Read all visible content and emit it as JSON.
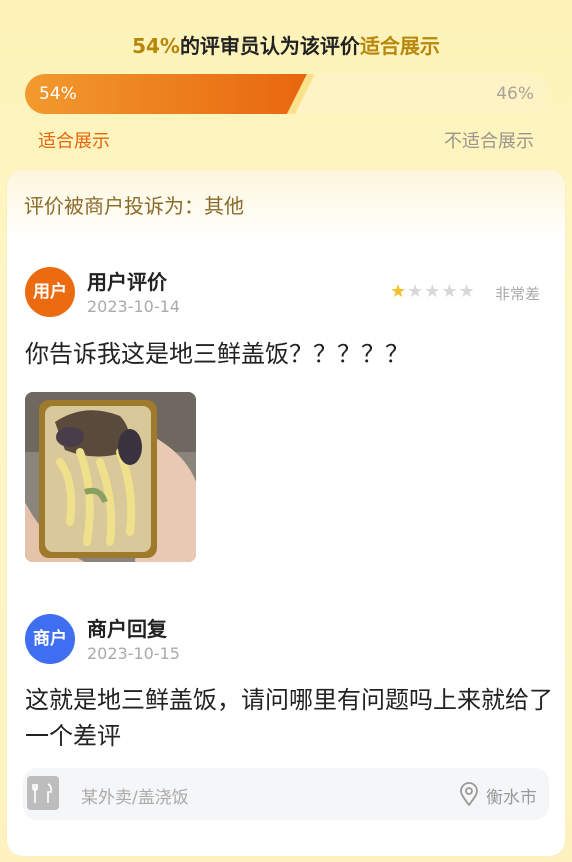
{
  "summary": {
    "title_percent": "54%",
    "title_middle": "的评审员认为该评价",
    "title_verdict": "适合展示",
    "yes_percent_label": "54%",
    "no_percent_label": "46%",
    "yes_fraction": 0.54,
    "yes_label": "适合展示",
    "no_label": "不适合展示"
  },
  "complaint": "评价被商户投诉为：其他",
  "user_review": {
    "avatar_label": "用户",
    "title": "用户评价",
    "date": "2023-10-14",
    "rating": 1,
    "rating_max": 5,
    "rating_text": "非常差",
    "text": "你告诉我这是地三鲜盖饭？？？？？"
  },
  "merchant_reply": {
    "avatar_label": "商户",
    "title": "商户回复",
    "date": "2023-10-15",
    "text": "这就是地三鲜盖饭，请问哪里有问题吗上来就给了一个差评"
  },
  "footer": {
    "shop": "某外卖/盖浇饭",
    "city": "衡水市",
    "shop_icon": "restaurant-icon",
    "location_icon": "location-pin-icon"
  },
  "colors": {
    "accent_orange": "#e8660f",
    "verdict_gold": "#b8860b",
    "merchant_blue": "#3f6ff0",
    "star_gold": "#f4c12b"
  }
}
